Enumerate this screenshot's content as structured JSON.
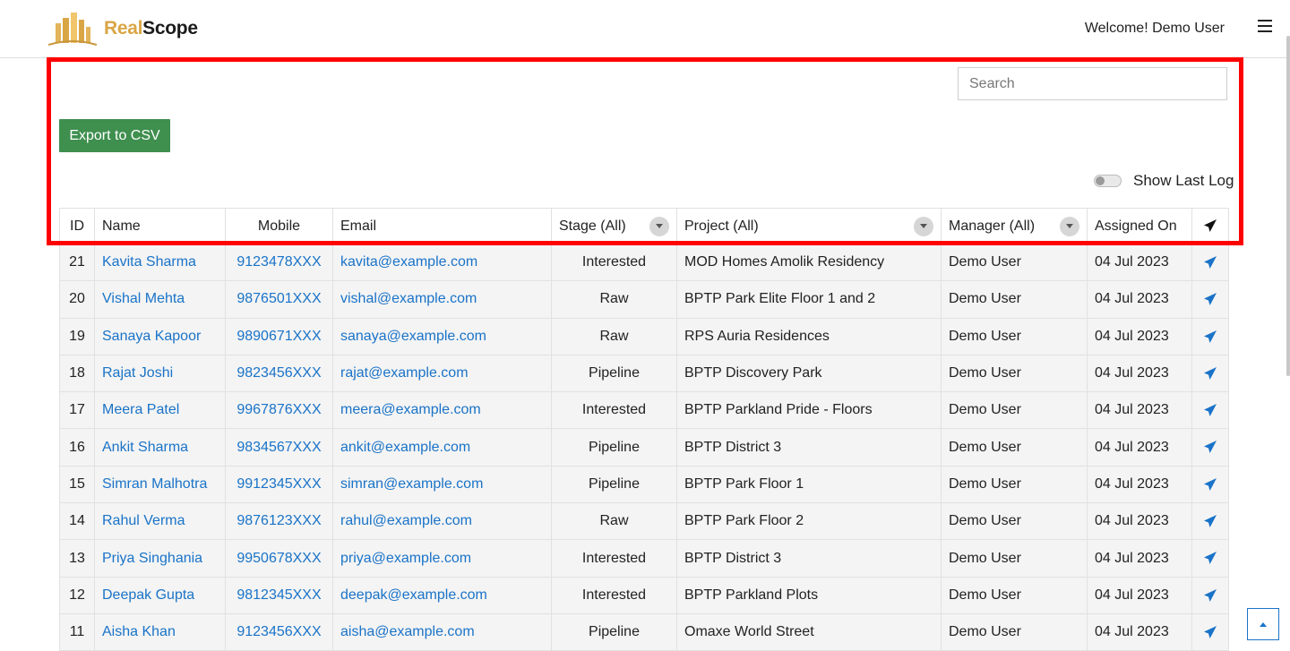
{
  "brand": {
    "part1": "Real",
    "part2": "Scope"
  },
  "header": {
    "welcome": "Welcome! Demo User"
  },
  "search": {
    "placeholder": "Search"
  },
  "toolbar": {
    "export_label": "Export to CSV",
    "toggle_label": "Show Last Log"
  },
  "columns": [
    "ID",
    "Name",
    "Mobile",
    "Email",
    "Stage (All)",
    "Project (All)",
    "Manager (All)",
    "Assigned On"
  ],
  "rows": [
    {
      "id": "21",
      "name": "Kavita Sharma",
      "mobile": "9123478XXX",
      "email": "kavita@example.com",
      "stage": "Interested",
      "project": "MOD Homes Amolik Residency",
      "manager": "Demo User",
      "assigned": "04 Jul 2023"
    },
    {
      "id": "20",
      "name": "Vishal Mehta",
      "mobile": "9876501XXX",
      "email": "vishal@example.com",
      "stage": "Raw",
      "project": "BPTP Park Elite Floor 1 and 2",
      "manager": "Demo User",
      "assigned": "04 Jul 2023"
    },
    {
      "id": "19",
      "name": "Sanaya Kapoor",
      "mobile": "9890671XXX",
      "email": "sanaya@example.com",
      "stage": "Raw",
      "project": "RPS Auria Residences",
      "manager": "Demo User",
      "assigned": "04 Jul 2023"
    },
    {
      "id": "18",
      "name": "Rajat Joshi",
      "mobile": "9823456XXX",
      "email": "rajat@example.com",
      "stage": "Pipeline",
      "project": "BPTP Discovery Park",
      "manager": "Demo User",
      "assigned": "04 Jul 2023"
    },
    {
      "id": "17",
      "name": "Meera Patel",
      "mobile": "9967876XXX",
      "email": "meera@example.com",
      "stage": "Interested",
      "project": "BPTP Parkland Pride - Floors",
      "manager": "Demo User",
      "assigned": "04 Jul 2023"
    },
    {
      "id": "16",
      "name": "Ankit Sharma",
      "mobile": "9834567XXX",
      "email": "ankit@example.com",
      "stage": "Pipeline",
      "project": "BPTP District 3",
      "manager": "Demo User",
      "assigned": "04 Jul 2023"
    },
    {
      "id": "15",
      "name": "Simran Malhotra",
      "mobile": "9912345XXX",
      "email": "simran@example.com",
      "stage": "Pipeline",
      "project": "BPTP Park Floor 1",
      "manager": "Demo User",
      "assigned": "04 Jul 2023"
    },
    {
      "id": "14",
      "name": "Rahul Verma",
      "mobile": "9876123XXX",
      "email": "rahul@example.com",
      "stage": "Raw",
      "project": "BPTP Park Floor 2",
      "manager": "Demo User",
      "assigned": "04 Jul 2023"
    },
    {
      "id": "13",
      "name": "Priya Singhania",
      "mobile": "9950678XXX",
      "email": "priya@example.com",
      "stage": "Interested",
      "project": "BPTP District 3",
      "manager": "Demo User",
      "assigned": "04 Jul 2023"
    },
    {
      "id": "12",
      "name": "Deepak Gupta",
      "mobile": "9812345XXX",
      "email": "deepak@example.com",
      "stage": "Interested",
      "project": "BPTP Parkland Plots",
      "manager": "Demo User",
      "assigned": "04 Jul 2023"
    },
    {
      "id": "11",
      "name": "Aisha Khan",
      "mobile": "9123456XXX",
      "email": "aisha@example.com",
      "stage": "Pipeline",
      "project": "Omaxe World Street",
      "manager": "Demo User",
      "assigned": "04 Jul 2023"
    }
  ],
  "colors": {
    "link": "#1a73c8",
    "export_bg": "#3f8f4f",
    "highlight": "#ff0000",
    "brand_gold": "#d9a646"
  },
  "icons": {
    "menu": "hamburger-icon",
    "send": "paper-plane-icon",
    "dropdown": "chevron-down-icon",
    "back_to_top": "chevron-up-icon"
  }
}
